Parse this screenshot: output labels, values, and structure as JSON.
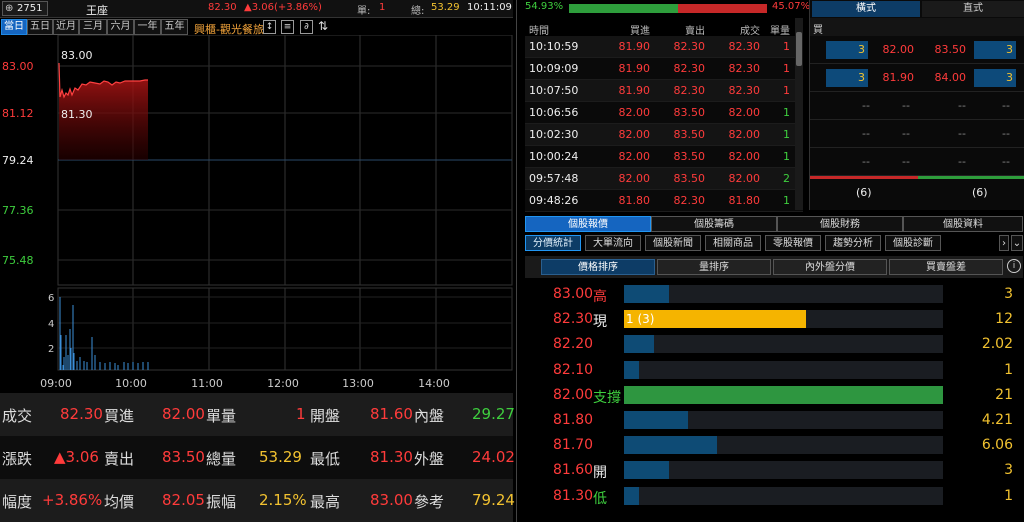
{
  "topbar": {
    "code": "2751",
    "name": "王座",
    "price": "82.30",
    "change": "▲3.06(+3.86%)",
    "unit_label": "單:",
    "unit_value": "1",
    "total_label": "總:",
    "total_value": "53.29",
    "time": "10:11:09",
    "industry": "興櫃-觀光餐旅"
  },
  "periods": [
    "當日",
    "五日",
    "近月",
    "三月",
    "六月",
    "一年",
    "五年"
  ],
  "chart": {
    "high_label": "83.00",
    "low_label": "81.30",
    "y_ticks": [
      "83.00",
      "81.12",
      "79.24",
      "77.36",
      "75.48"
    ],
    "vol_ticks": [
      "6",
      "4",
      "2"
    ],
    "x_ticks": [
      "09:00",
      "10:00",
      "11:00",
      "12:00",
      "13:00",
      "14:00"
    ]
  },
  "stats": {
    "row1": {
      "l1": "成交",
      "v1": "82.30",
      "l2": "買進",
      "v2": "82.00",
      "l3": "單量",
      "v3": "1",
      "l4": "開盤",
      "v4": "81.60",
      "l5": "內盤",
      "v5": "29.27"
    },
    "row2": {
      "l1": "漲跌",
      "v1": "▲3.06",
      "l2": "賣出",
      "v2": "83.50",
      "l3": "總量",
      "v3": "53.29",
      "l4": "最低",
      "v4": "81.30",
      "l5": "外盤",
      "v5": "24.02"
    },
    "row3": {
      "l1": "幅度",
      "v1": "+3.86%",
      "l2": "均價",
      "v2": "82.05",
      "l3": "振幅",
      "v3": "2.15%",
      "l4": "最高",
      "v4": "83.00",
      "l5": "參考",
      "v5": "79.24"
    }
  },
  "ratio": {
    "left": "54.93%",
    "right": "45.07%",
    "left_frac": 0.5493
  },
  "ticks": {
    "headers": [
      "時間",
      "買進",
      "賣出",
      "成交",
      "單量"
    ],
    "rows": [
      {
        "time": "10:10:59",
        "bid": "81.90",
        "ask": "82.30",
        "deal": "82.30",
        "vol": "1"
      },
      {
        "time": "10:09:09",
        "bid": "81.90",
        "ask": "82.30",
        "deal": "82.30",
        "vol": "1"
      },
      {
        "time": "10:07:50",
        "bid": "81.90",
        "ask": "82.30",
        "deal": "82.30",
        "vol": "1"
      },
      {
        "time": "10:06:56",
        "bid": "82.00",
        "ask": "83.50",
        "deal": "82.00",
        "vol": "1"
      },
      {
        "time": "10:02:30",
        "bid": "82.00",
        "ask": "83.50",
        "deal": "82.00",
        "vol": "1"
      },
      {
        "time": "10:00:24",
        "bid": "82.00",
        "ask": "83.50",
        "deal": "82.00",
        "vol": "1"
      },
      {
        "time": "09:57:48",
        "bid": "82.00",
        "ask": "83.50",
        "deal": "82.00",
        "vol": "2"
      },
      {
        "time": "09:48:26",
        "bid": "81.80",
        "ask": "82.30",
        "deal": "81.80",
        "vol": "1"
      }
    ]
  },
  "book": {
    "tab1": "橫式",
    "tab2": "直式",
    "buy_label": "買",
    "rows": [
      {
        "bq": "3",
        "bp": "82.00",
        "ap": "83.50",
        "aq": "3"
      },
      {
        "bq": "3",
        "bp": "81.90",
        "ap": "84.00",
        "aq": "3"
      },
      {
        "bq": "--",
        "bp": "--",
        "ap": "--",
        "aq": "--"
      },
      {
        "bq": "--",
        "bp": "--",
        "ap": "--",
        "aq": "--"
      },
      {
        "bq": "--",
        "bp": "--",
        "ap": "--",
        "aq": "--"
      }
    ],
    "buy_total": "(6)",
    "sell_total": "(6)"
  },
  "tabs_main": [
    "個股報價",
    "個股籌碼",
    "個股財務",
    "個股資料"
  ],
  "tabs_sub": [
    "分價統計",
    "大單流向",
    "個股新聞",
    "相關商品",
    "零股報價",
    "趨勢分析",
    "個股診斷"
  ],
  "tabs_sort": [
    "價格排序",
    "量排序",
    "內外盤分價",
    "買賣盤差"
  ],
  "dist": [
    {
      "price": "83.00",
      "tag": "高",
      "vol": "3",
      "frac": 0.14,
      "kind": "n",
      "tagclr": "red",
      "inbar": ""
    },
    {
      "price": "82.30",
      "tag": "現",
      "vol": "12",
      "frac": 0.57,
      "kind": "cur",
      "tagclr": "white",
      "inbar": "1 (3)"
    },
    {
      "price": "82.20",
      "tag": "",
      "vol": "2.02",
      "frac": 0.095,
      "kind": "n",
      "tagclr": "white",
      "inbar": ""
    },
    {
      "price": "82.10",
      "tag": "",
      "vol": "1",
      "frac": 0.048,
      "kind": "n",
      "tagclr": "white",
      "inbar": ""
    },
    {
      "price": "82.00",
      "tag": "支撐",
      "vol": "21",
      "frac": 1.0,
      "kind": "sup",
      "tagclr": "green",
      "inbar": ""
    },
    {
      "price": "81.80",
      "tag": "",
      "vol": "4.21",
      "frac": 0.2,
      "kind": "n",
      "tagclr": "white",
      "inbar": ""
    },
    {
      "price": "81.70",
      "tag": "",
      "vol": "6.06",
      "frac": 0.29,
      "kind": "n",
      "tagclr": "white",
      "inbar": ""
    },
    {
      "price": "81.60",
      "tag": "開",
      "vol": "3",
      "frac": 0.14,
      "kind": "n",
      "tagclr": "white",
      "inbar": ""
    },
    {
      "price": "81.30",
      "tag": "低",
      "vol": "1",
      "frac": 0.048,
      "kind": "n",
      "tagclr": "green",
      "inbar": ""
    }
  ],
  "colors": {
    "up": "#ff3b3b",
    "down": "#3ecf3e",
    "accent": "#1565c0",
    "volume": "#f2c230"
  }
}
